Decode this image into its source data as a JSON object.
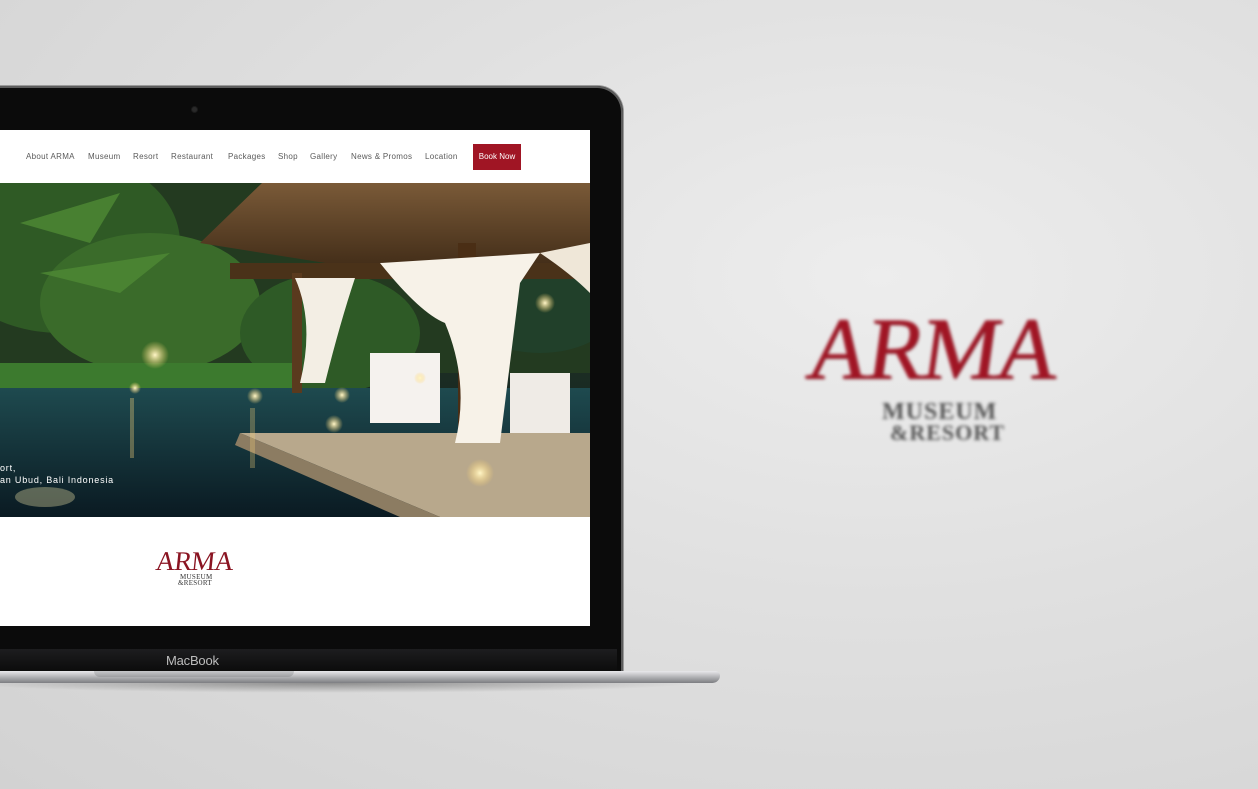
{
  "laptop": {
    "brand": "MacBook"
  },
  "site": {
    "nav": {
      "items": [
        "About ARMA",
        "Museum",
        "Resort",
        "Restaurant",
        "Packages",
        "Shop",
        "Gallery",
        "News & Promos",
        "Location"
      ],
      "book_label": "Book Now"
    },
    "hero": {
      "caption_line1": "ort,",
      "caption_line2": "an Ubud, Bali Indonesia"
    },
    "footer_logo": {
      "title": "ARMA",
      "line1": "MUSEUM",
      "line2": "&RESORT"
    }
  },
  "big_logo": {
    "title": "ARMA",
    "line1": "MUSEUM",
    "line2": "&RESORT"
  },
  "colors": {
    "brand_red": "#a01524",
    "background": "#e0e0e0"
  }
}
